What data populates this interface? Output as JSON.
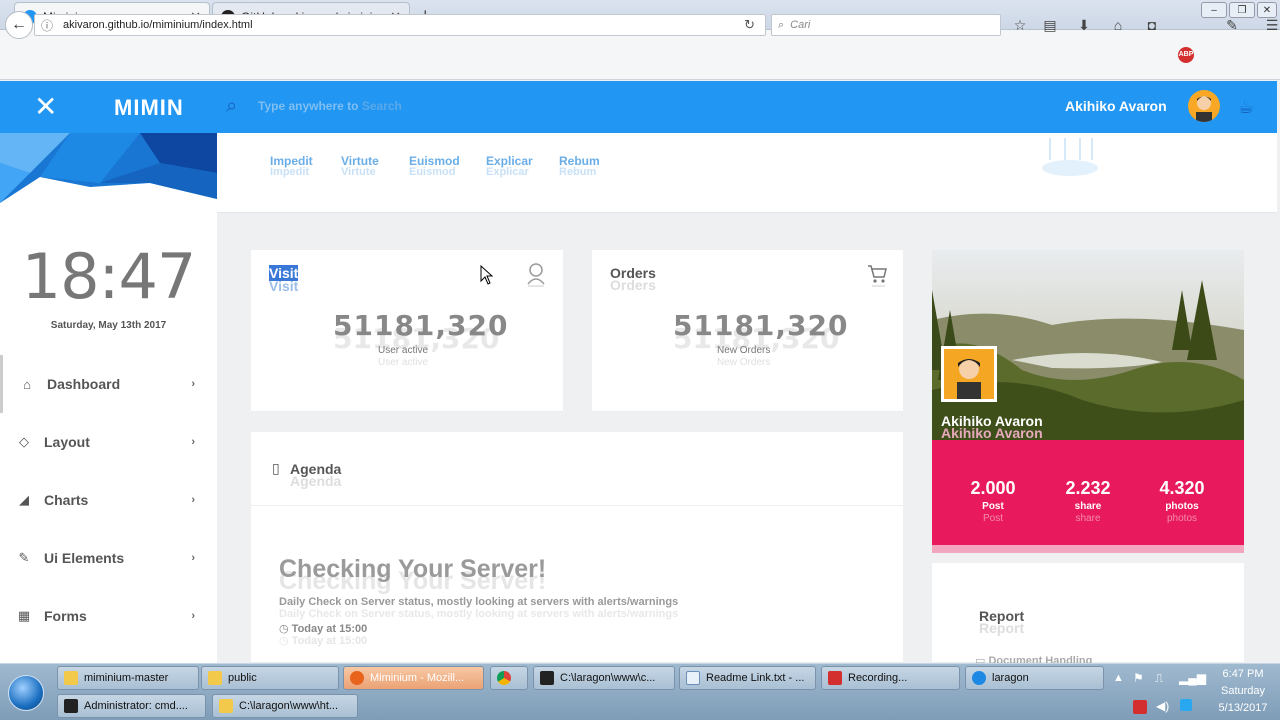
{
  "browser": {
    "tabs": [
      {
        "title": "Miminium",
        "active": true
      },
      {
        "title": "GitHub - akivaron/miminiun",
        "active": false
      }
    ],
    "url": "akivaron.github.io/miminium/index.html",
    "search_placeholder": "Cari"
  },
  "app": {
    "brand": "MIMIN",
    "search_prefix": "Type anywhere to ",
    "search_bold": "Search",
    "user_name": "Akihiko Avaron",
    "accent": "#2196f3"
  },
  "subnav": {
    "links": [
      "Impedit",
      "Virtute",
      "Euismod",
      "Explicar",
      "Rebum"
    ]
  },
  "sidebar": {
    "time": "18:47",
    "date": "Saturday, May 13th 2017",
    "items": [
      {
        "label": "Dashboard",
        "icon": "home-icon"
      },
      {
        "label": "Layout",
        "icon": "diamond-icon"
      },
      {
        "label": "Charts",
        "icon": "area-chart-icon"
      },
      {
        "label": "Ui Elements",
        "icon": "pencil-square-icon"
      },
      {
        "label": "Forms",
        "icon": "table-icon"
      }
    ]
  },
  "cards": {
    "visit": {
      "title": "Visit",
      "value": "51181,320",
      "label": "User active"
    },
    "orders": {
      "title": "Orders",
      "value": "51181,320",
      "label": "New Orders"
    },
    "agenda": {
      "title": "Agenda"
    }
  },
  "agenda": {
    "heading": "Checking Your Server!",
    "description": "Daily Check on Server status, mostly looking at servers with alerts/warnings",
    "time": "Today at 15:00"
  },
  "profile": {
    "name": "Akihiko Avaron",
    "stats": [
      {
        "value": "2.000",
        "label": "Post"
      },
      {
        "value": "2.232",
        "label": "share"
      },
      {
        "value": "4.320",
        "label": "photos"
      }
    ],
    "pink": "#e8195c"
  },
  "report": {
    "title": "Report",
    "item": "Document Handling"
  },
  "taskbar": {
    "row1": [
      {
        "label": "miminium-master"
      },
      {
        "label": "public"
      },
      {
        "label": "Miminium - Mozill..."
      },
      {
        "label": ""
      },
      {
        "label": "C:\\laragon\\www\\c..."
      },
      {
        "label": "Readme Link.txt - ..."
      },
      {
        "label": "Recording..."
      },
      {
        "label": "laragon"
      }
    ],
    "row2": [
      {
        "label": "Administrator: cmd...."
      },
      {
        "label": "C:\\laragon\\www\\ht..."
      }
    ],
    "clock": {
      "time": "6:47 PM",
      "day": "Saturday",
      "date": "5/13/2017"
    }
  }
}
